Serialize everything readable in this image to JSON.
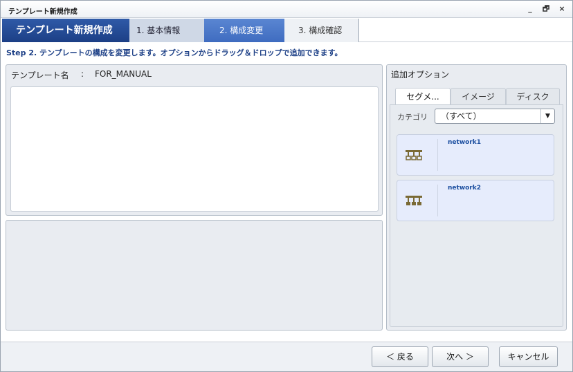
{
  "window": {
    "title": "テンプレート新規作成",
    "min_glyph": "_",
    "max_glyph": "🗗",
    "close_glyph": "×"
  },
  "wizard": {
    "title": "テンプレート新規作成",
    "steps": [
      {
        "label": "1. 基本情報",
        "state": "done"
      },
      {
        "label": "2. 構成変更",
        "state": "active"
      },
      {
        "label": "3. 構成確認",
        "state": "pending"
      }
    ]
  },
  "instruction": "Step 2. テンプレートの構成を変更します。オプションからドラッグ＆ドロップで追加できます。",
  "template": {
    "name_label": "テンプレート名",
    "colon": ":",
    "name_value": "FOR_MANUAL"
  },
  "options_panel": {
    "title": "追加オプション",
    "tabs": [
      "セグメ...",
      "イメージ",
      "ディスク"
    ],
    "category_label": "カテゴリ",
    "category_value": "（すべて）",
    "dropdown_glyph": "▼",
    "items": [
      {
        "name": "network1",
        "icon": "network-segment-icon"
      },
      {
        "name": "network2",
        "icon": "network-segment-icon"
      }
    ]
  },
  "colors": {
    "accent_dark": "#1c3f86",
    "accent_active": "#3f6cc0",
    "item_text": "#1c4fa0",
    "network_icon": "#7a6a35"
  },
  "buttons": {
    "back": "＜ 戻る",
    "next": "次へ ＞",
    "cancel": "キャンセル"
  }
}
